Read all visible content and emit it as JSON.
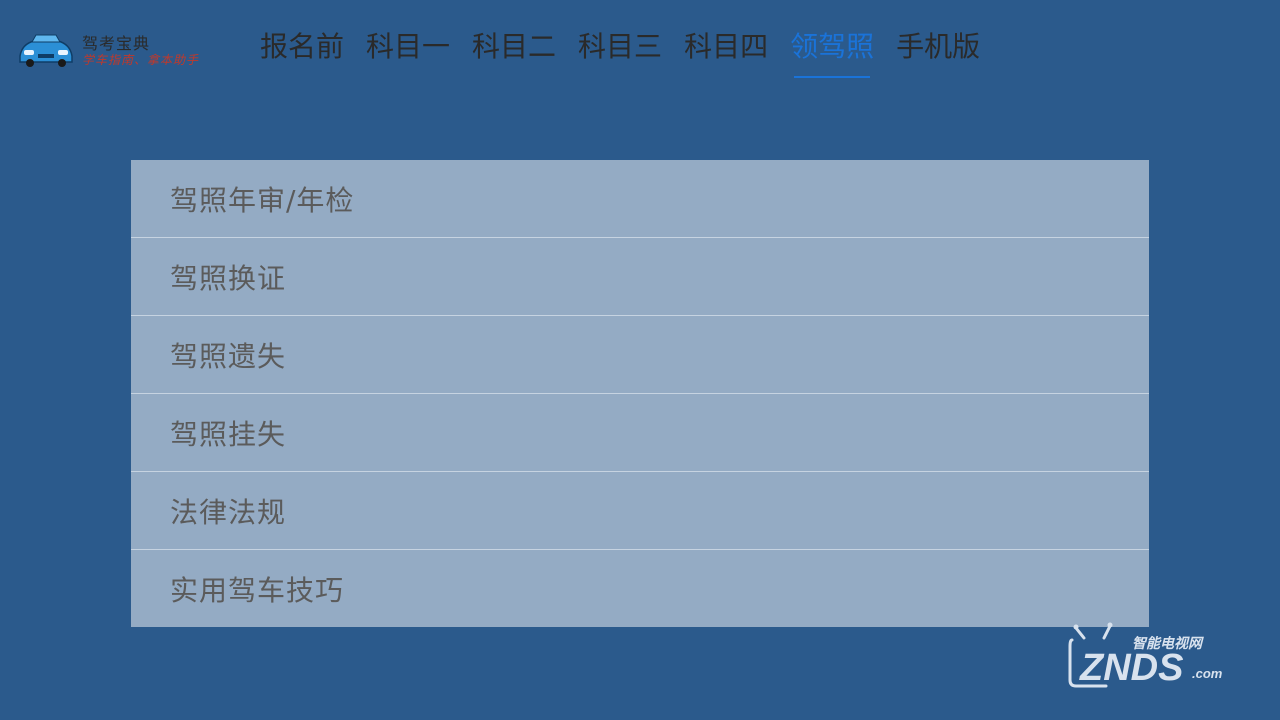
{
  "logo": {
    "title": "驾考宝典",
    "slogan": "学车指南、拿本助手"
  },
  "nav": {
    "items": [
      {
        "label": "报名前"
      },
      {
        "label": "科目一"
      },
      {
        "label": "科目二"
      },
      {
        "label": "科目三"
      },
      {
        "label": "科目四"
      },
      {
        "label": "领驾照",
        "active": true
      },
      {
        "label": "手机版"
      }
    ]
  },
  "menu": {
    "items": [
      {
        "label": "驾照年审/年检"
      },
      {
        "label": "驾照换证"
      },
      {
        "label": "驾照遗失"
      },
      {
        "label": "驾照挂失"
      },
      {
        "label": "法律法规"
      },
      {
        "label": "实用驾车技巧"
      }
    ]
  },
  "watermark": {
    "top_text": "智能电视网",
    "brand": "ZNDS",
    "suffix": ".com"
  },
  "colors": {
    "background": "#2b5a8c",
    "active_nav": "#1a73d9",
    "panel": "#94abc4"
  }
}
